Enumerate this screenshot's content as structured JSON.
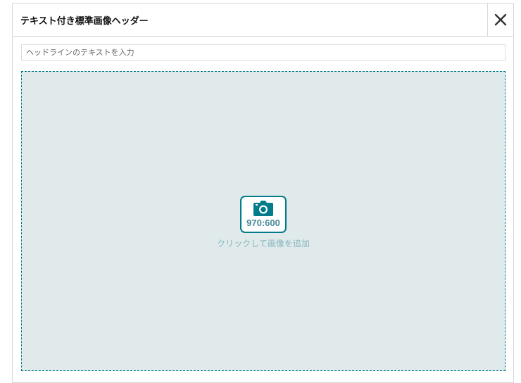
{
  "dialog": {
    "title": "テキスト付き標準画像ヘッダー",
    "close_icon": "close-icon"
  },
  "headline": {
    "placeholder": "ヘッドラインのテキストを入力",
    "value": ""
  },
  "image_upload": {
    "icon": "camera-icon",
    "aspect_ratio": "970:600",
    "label": "クリックして画像を追加"
  },
  "colors": {
    "accent": "#007c8a",
    "dropzone_background": "#e1eaeb",
    "label_text": "#85b6bd"
  }
}
